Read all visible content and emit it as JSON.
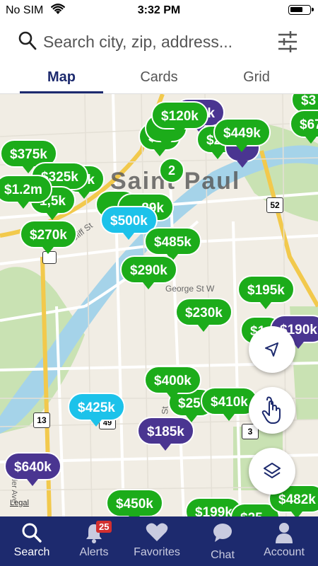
{
  "status_bar": {
    "carrier": "No SIM",
    "time": "3:32 PM"
  },
  "search": {
    "placeholder": "Search city, zip, address..."
  },
  "tabs": [
    {
      "label": "Map",
      "active": true
    },
    {
      "label": "Cards",
      "active": false
    },
    {
      "label": "Grid",
      "active": false
    }
  ],
  "map": {
    "city_label": "Saint Paul",
    "street_labels": {
      "cliff": "Cliff St",
      "george": "George St W",
      "wachtler": "Wachtler Ave",
      "st": "St"
    },
    "highways": [
      "52",
      "13",
      "3",
      "49"
    ],
    "legal": "Legal",
    "cluster": "2",
    "pins": [
      "$120k",
      "$5k",
      "$449k",
      "$375k",
      "$325k",
      "0k",
      "$1.2m",
      "1,5k",
      "$270k",
      "$500k",
      "89k",
      "$485k",
      "$290k",
      "$195k",
      "$230k",
      "$190k",
      "$1",
      "$400k",
      "$25",
      "$410k",
      "$425k",
      "$185k",
      "$640k",
      "$450k",
      "$199k",
      "$482k",
      "$67",
      "$3",
      "$",
      "$2",
      "$25"
    ]
  },
  "nav": [
    {
      "label": "Search",
      "active": true
    },
    {
      "label": "Alerts",
      "badge": "25"
    },
    {
      "label": "Favorites"
    },
    {
      "label": "Chat"
    },
    {
      "label": "Account"
    }
  ]
}
